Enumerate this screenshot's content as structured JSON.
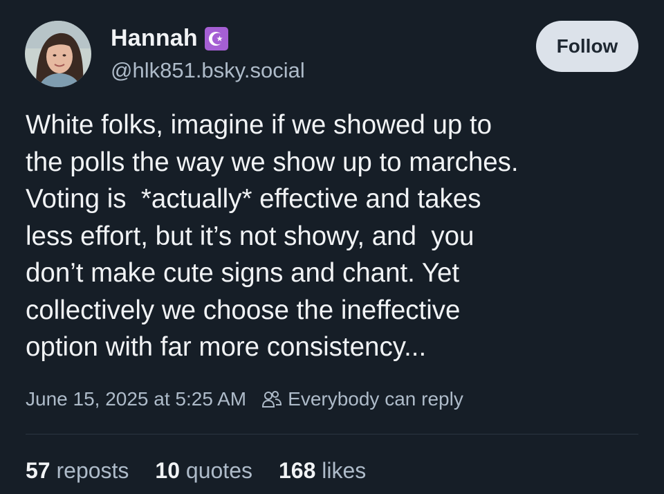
{
  "author": {
    "display_name": "Hannah",
    "handle": "@hlk851.bsky.social",
    "badge_icon": "star-and-crescent-icon",
    "badge_color": "#a55fd4"
  },
  "follow_button": {
    "label": "Follow"
  },
  "post": {
    "text": "White folks, imagine if we showed up to\nthe polls the way we show up to marches.\nVoting is  *actually* effective and takes\nless effort, but it’s not showy, and  you\ndon’t make cute signs and chant. Yet\ncollectively we choose the ineffective\noption with far more consistency..."
  },
  "meta": {
    "timestamp": "June 15, 2025 at 5:25 AM",
    "reply_icon": "people-icon",
    "reply_setting": "Everybody can reply"
  },
  "stats": {
    "reposts_count": "57",
    "reposts_label": "reposts",
    "quotes_count": "10",
    "quotes_label": "quotes",
    "likes_count": "168",
    "likes_label": "likes"
  },
  "colors": {
    "background": "#161e27",
    "text_primary": "#f1f3f5",
    "text_secondary": "#aebbc9",
    "follow_button_bg": "#dce2ea"
  }
}
